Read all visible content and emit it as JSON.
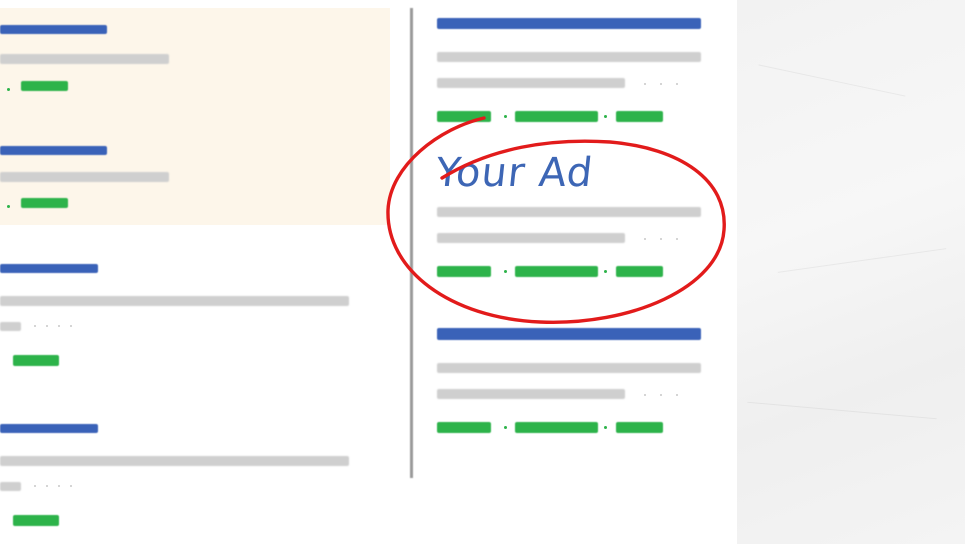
{
  "annotation": {
    "label": "Your Ad"
  },
  "colors": {
    "blue": "#3a62b8",
    "gray": "#cfcfcf",
    "green": "#2db34a",
    "ad_background": "#fdf6ea",
    "ink": "#3d66b5",
    "circle": "#e21b1b"
  },
  "icons": [
    "ellipsis-icon"
  ]
}
